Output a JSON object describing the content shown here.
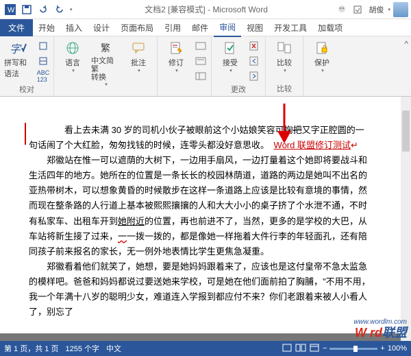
{
  "titlebar": {
    "title": "文档2 [兼容模式] - Microsoft Word",
    "user": "胡俊"
  },
  "menu": {
    "file": "文件",
    "tabs": [
      "开始",
      "插入",
      "设计",
      "页面布局",
      "引用",
      "邮件",
      "审阅",
      "视图",
      "开发工具",
      "加载项"
    ]
  },
  "ribbon": {
    "spelling": "拼写和语法",
    "language": "语言",
    "simplified": "中文简繁\n转换",
    "comment": "批注",
    "track": "修订",
    "accept": "接受",
    "compare": "比较",
    "protect": "保护",
    "group1": "校对",
    "group2": "更改",
    "group3": "比较"
  },
  "doc": {
    "p1a": "　　看上去未满 30 岁的司机小伙子被眼前这个小姑娘笑容可掬",
    "p1del": "把",
    "p1b": "又字正腔圆的一句话闹了个大红脸，匆匆找钱的时候，连零头都没好意思收。",
    "ins": "Word 联盟修订测试",
    "p2": "郑徽站在惟一可以遮荫的大树下，一边用手扇风，一边打量着这个她即将要战斗和生活四年的地方。她所在的位置是一条长长的校园林荫道，道路的两边是她叫不出名的亚热带树木，可以想象黄昏的时候散步在这样一条道路上应该是比较有意境的事情，然而现在整条路的人行道上基本被熙熙攘攘的人和大大小小的桌子挤了个水泄不通，不时有私家车、出租车开到",
    "p2u": "她附近",
    "p2b": "的位置，再也前进不了，当然，更多的是学校的大巴，从车站将新生接了过来，",
    "p2c": "一拨一拨的，都是像她一样拖着大件行李的年轻面孔，还有陪同孩子前来报名的家长，无一例外地表情比学生更焦急凝重。",
    "p3": "郑徽看着他们就笑了，她想，要是她妈妈跟着来了，应该也是这付皇帝不急太监急的模样吧。爸爸和妈妈都说过要送她来学校，可是她在他们面前拍了胸脯，\"不用不用，我一个年满十八岁的聪明少女，难道连入学报到都应付不来？你们老跟着来被人小看人了，别忘了"
  },
  "status": {
    "page": "第 1 页，共 1 页",
    "words": "1255 个字",
    "lang": "中文",
    "zoom": "100%"
  },
  "watermark": {
    "a": "W   rd",
    "b": "联盟",
    "url": "www.wordlm.com"
  }
}
